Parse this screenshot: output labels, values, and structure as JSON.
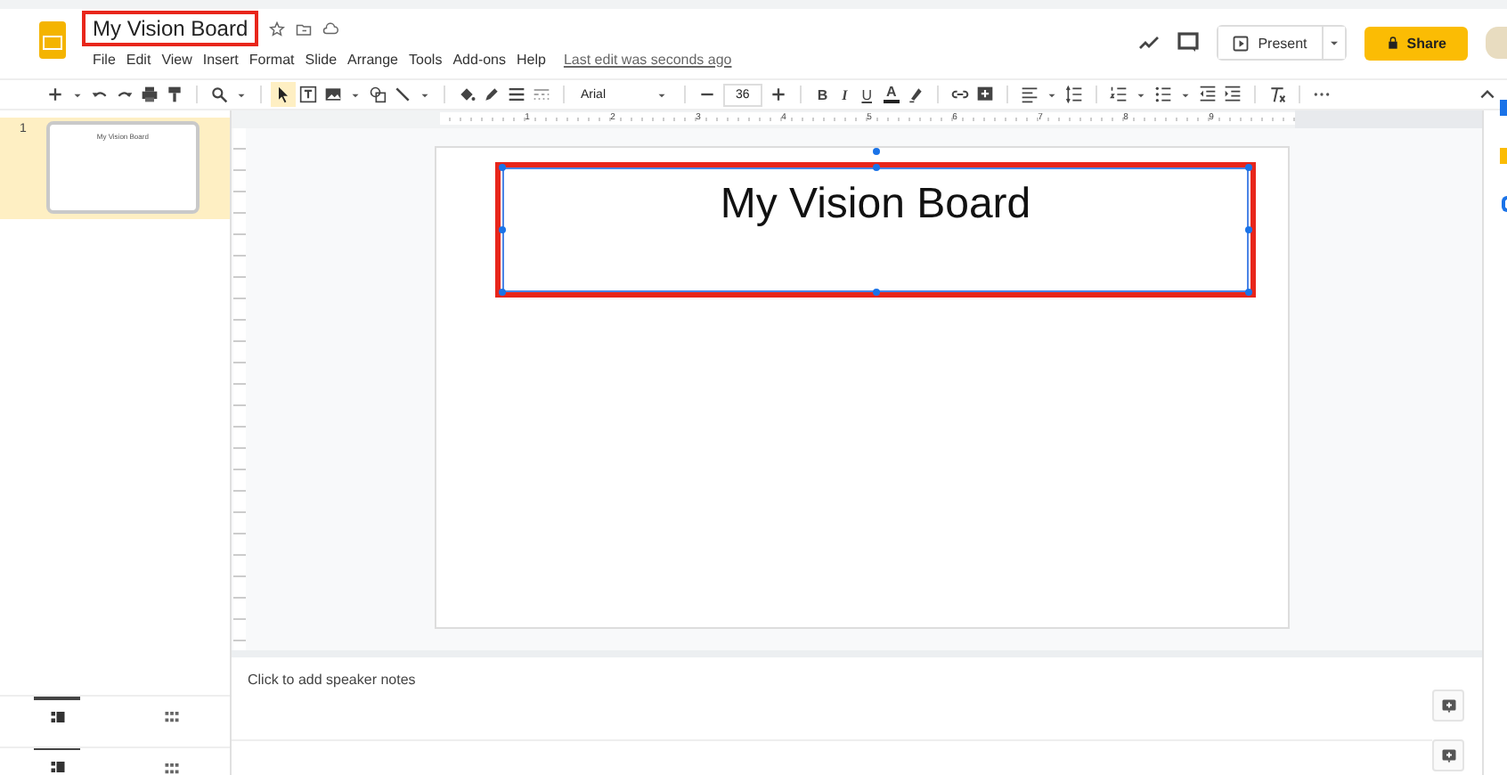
{
  "document": {
    "title": "My Vision Board",
    "highlighted": true,
    "last_edit": "Last edit was seconds ago"
  },
  "menu": [
    "File",
    "Edit",
    "View",
    "Insert",
    "Format",
    "Slide",
    "Arrange",
    "Tools",
    "Add-ons",
    "Help"
  ],
  "header_buttons": {
    "present": "Present",
    "share": "Share"
  },
  "toolbar": {
    "font": "Arial",
    "font_size": "36",
    "format_buttons": [
      "B",
      "I",
      "U",
      "A"
    ]
  },
  "ruler_labels": [
    "1",
    "2",
    "3",
    "4",
    "5",
    "6",
    "7",
    "8",
    "9"
  ],
  "slides": [
    {
      "number": "1",
      "title": "My Vision Board",
      "selected": true
    }
  ],
  "canvas": {
    "title_box": {
      "text": "My Vision Board",
      "selected": true,
      "highlighted": true
    }
  },
  "notes": {
    "placeholder": "Click to add speaker notes"
  }
}
